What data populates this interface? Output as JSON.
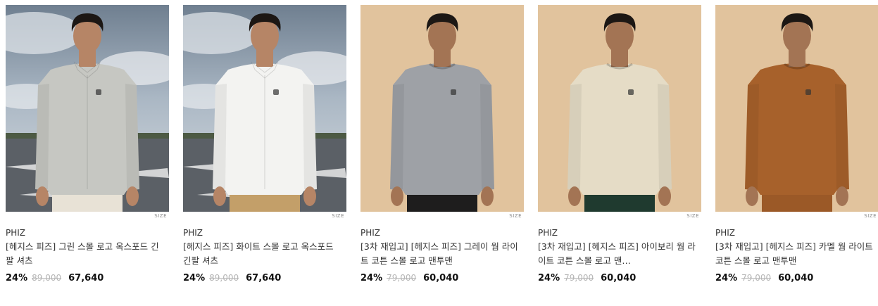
{
  "products": [
    {
      "brand": "PHIZ",
      "title": "[헤지스 피즈] 그린 스몰 로고 옥스포드 긴팔 셔츠",
      "discount": "24%",
      "original_price": "89,000",
      "sale_price": "67,640",
      "size_label": "SIZE",
      "background": "sky",
      "garment_color": "#c6c7c2",
      "bottom_color": "#e8e2d6",
      "skin_color": "#b68566"
    },
    {
      "brand": "PHIZ",
      "title": "[헤지스 피즈] 화이트 스몰 로고 옥스포드 긴팔 셔츠",
      "discount": "24%",
      "original_price": "89,000",
      "sale_price": "67,640",
      "size_label": "SIZE",
      "background": "sky",
      "garment_color": "#f3f3f1",
      "bottom_color": "#c39f69",
      "skin_color": "#b68566"
    },
    {
      "brand": "PHIZ",
      "title": "[3차 재입고] [헤지스 피즈] 그레이 웜 라이트 코튼 스몰 로고 맨투맨",
      "discount": "24%",
      "original_price": "79,000",
      "sale_price": "60,040",
      "size_label": "SIZE",
      "background": "beige",
      "garment_color": "#9ea1a6",
      "bottom_color": "#1e1d1d",
      "skin_color": "#a37454"
    },
    {
      "brand": "PHIZ",
      "title": "[3차 재입고] [헤지스 피즈] 아이보리 웜 라이트 코튼 스몰 로고 맨…",
      "discount": "24%",
      "original_price": "79,000",
      "sale_price": "60,040",
      "size_label": "SIZE",
      "background": "beige",
      "garment_color": "#e5dcc6",
      "bottom_color": "#1f3a2f",
      "skin_color": "#a37454"
    },
    {
      "brand": "PHIZ",
      "title": "[3차 재입고] [헤지스 피즈] 카멜 웜 라이트 코튼 스몰 로고 맨투맨",
      "discount": "24%",
      "original_price": "79,000",
      "sale_price": "60,040",
      "size_label": "SIZE",
      "background": "beige",
      "garment_color": "#a7612b",
      "bottom_color": "#9b5927",
      "skin_color": "#a37454"
    }
  ]
}
